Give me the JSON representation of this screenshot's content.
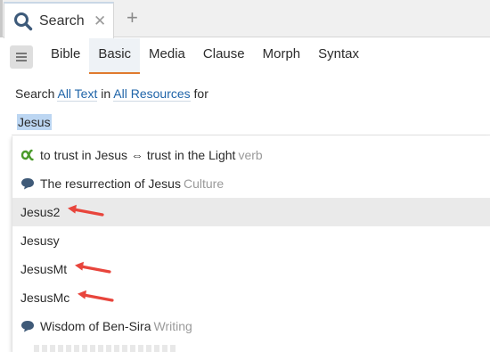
{
  "tabbar": {
    "tab_title": "Search",
    "close_glyph": "✕",
    "add_glyph": "+",
    "icons": {
      "tab": "search-icon",
      "close": "close-icon",
      "add": "plus-icon"
    }
  },
  "toolbar": {
    "menu_icon": "hamburger-menu-icon",
    "tabs": [
      {
        "label": "Bible",
        "active": false
      },
      {
        "label": "Basic",
        "active": true
      },
      {
        "label": "Media",
        "active": false
      },
      {
        "label": "Clause",
        "active": false
      },
      {
        "label": "Morph",
        "active": false
      },
      {
        "label": "Syntax",
        "active": false
      }
    ],
    "active_underline_color": "#e07a2e"
  },
  "query": {
    "prefix": "Search",
    "scope_link": "All Text",
    "in_word": "in",
    "resources_link": "All Resources",
    "suffix": "for",
    "link_color": "#1f64a8"
  },
  "search": {
    "value": "Jesus",
    "selection_color": "#bcd6f2"
  },
  "suggestions": [
    {
      "label": "to trust in Jesus ⇔ trust in the Light",
      "kind": "verb",
      "icon": "alpha-sense-icon",
      "highlight": false,
      "arrow": false
    },
    {
      "label": "The resurrection of Jesus",
      "kind": "Culture",
      "icon": "speech-bubble-icon",
      "highlight": false,
      "arrow": false
    },
    {
      "label": "Jesus2",
      "kind": "",
      "icon": "",
      "highlight": true,
      "arrow": true
    },
    {
      "label": "Jesusy",
      "kind": "",
      "icon": "",
      "highlight": false,
      "arrow": false
    },
    {
      "label": "JesusMt",
      "kind": "",
      "icon": "",
      "highlight": false,
      "arrow": true
    },
    {
      "label": "JesusMc",
      "kind": "",
      "icon": "",
      "highlight": false,
      "arrow": true
    },
    {
      "label": "Wisdom of Ben-Sira",
      "kind": "Writing",
      "icon": "speech-bubble-icon",
      "highlight": false,
      "arrow": false
    }
  ],
  "colors": {
    "alpha_icon": "#4a9a2a",
    "bubble_icon": "#3f5a78",
    "annotation_arrow": "#e8453c",
    "kind_text": "#9a9a9a"
  }
}
